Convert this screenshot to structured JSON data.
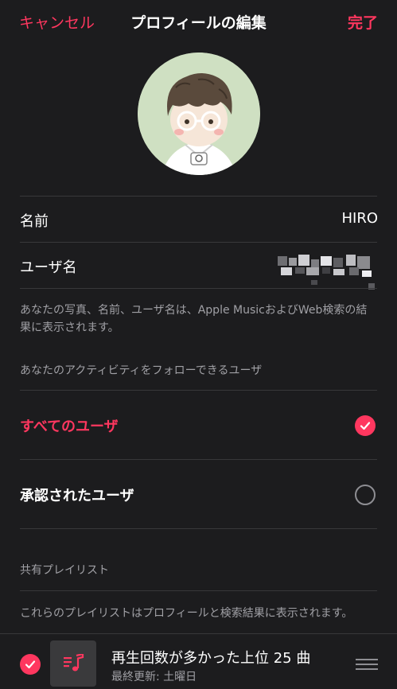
{
  "nav": {
    "cancel": "キャンセル",
    "title": "プロフィールの編集",
    "done": "完了"
  },
  "profile": {
    "name_label": "名前",
    "name_value": "HIRO",
    "username_label": "ユーザ名",
    "note": "あなたの写真、名前、ユーザ名は、Apple MusicおよびWeb検索の結果に表示されます。"
  },
  "followers": {
    "header": "あなたのアクティビティをフォローできるユーザ",
    "options": [
      {
        "label": "すべてのユーザ",
        "selected": true
      },
      {
        "label": "承認されたユーザ",
        "selected": false
      }
    ]
  },
  "shared": {
    "header": "共有プレイリスト",
    "note": "これらのプレイリストはプロフィールと検索結果に表示されます。",
    "playlist": {
      "title": "再生回数が多かった上位 25 曲",
      "subtitle": "最終更新: 土曜日"
    }
  },
  "colors": {
    "accent": "#ff375f",
    "background": "#1c1c1e",
    "secondary_text": "#a0a0a5"
  }
}
